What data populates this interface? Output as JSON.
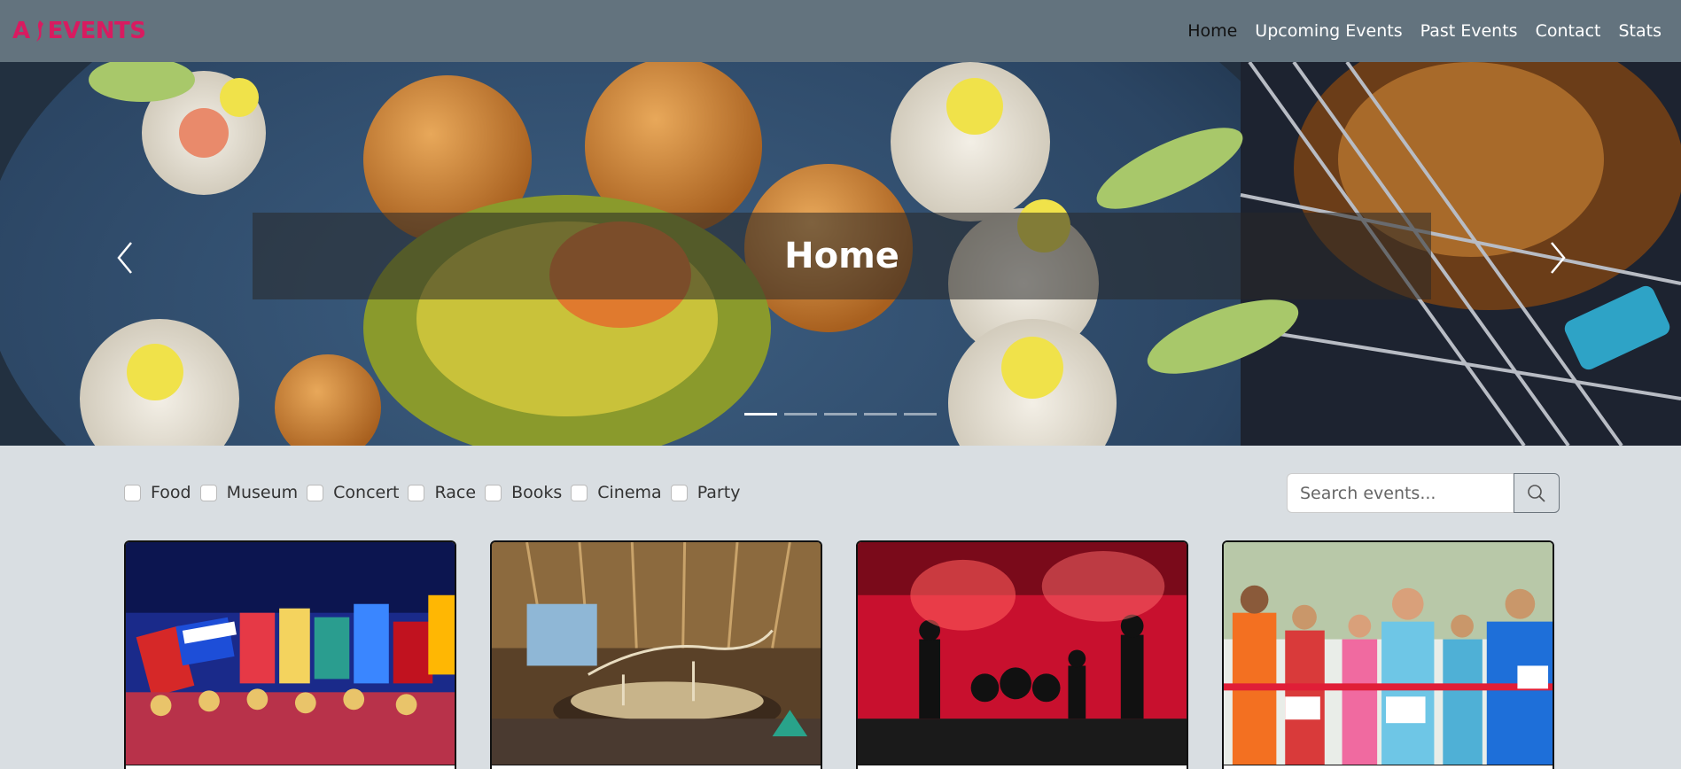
{
  "brand": {
    "name": "EVENTS",
    "color": "#d81b60"
  },
  "nav": {
    "items": [
      {
        "label": "Home",
        "active": true
      },
      {
        "label": "Upcoming Events",
        "active": false
      },
      {
        "label": "Past Events",
        "active": false
      },
      {
        "label": "Contact",
        "active": false
      },
      {
        "label": "Stats",
        "active": false
      }
    ]
  },
  "hero": {
    "caption": "Home",
    "prev_icon": "chevron-left-icon",
    "next_icon": "chevron-right-icon",
    "slides_count": 5,
    "active_slide": 1
  },
  "filters": {
    "categories": [
      {
        "label": "Food",
        "checked": false
      },
      {
        "label": "Museum",
        "checked": false
      },
      {
        "label": "Concert",
        "checked": false
      },
      {
        "label": "Race",
        "checked": false
      },
      {
        "label": "Books",
        "checked": false
      },
      {
        "label": "Cinema",
        "checked": false
      },
      {
        "label": "Party",
        "checked": false
      }
    ]
  },
  "search": {
    "placeholder": "Search events...",
    "value": "",
    "icon": "search-icon"
  },
  "cards": [
    {
      "image": "festival-flags-image"
    },
    {
      "image": "dinosaur-museum-image"
    },
    {
      "image": "concert-stage-image"
    },
    {
      "image": "marathon-finish-image"
    }
  ],
  "colors": {
    "navbar": "#63737e",
    "page_bg": "#d9dee2",
    "accent": "#d81b60"
  }
}
